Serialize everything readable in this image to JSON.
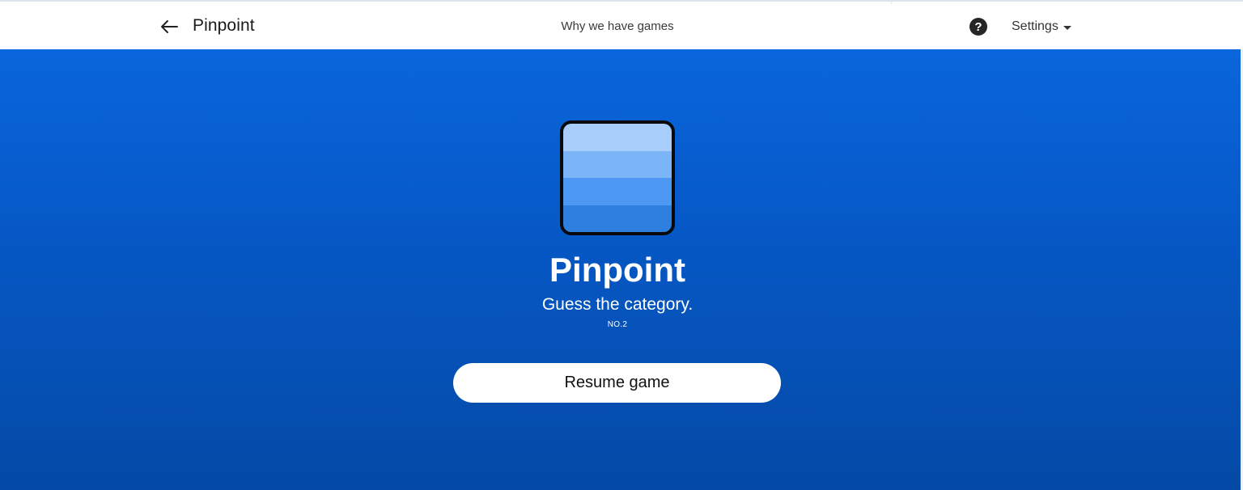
{
  "header": {
    "brand": "Pinpoint",
    "center_link": "Why we have games",
    "help_glyph": "?",
    "settings_label": "Settings"
  },
  "game": {
    "title": "Pinpoint",
    "subtitle": "Guess the category.",
    "number": "NO.2",
    "resume_label": "Resume game"
  },
  "icons": {
    "back": "arrow-left-icon",
    "help": "question-circle-icon",
    "settings_caret": "caret-down-icon"
  },
  "colors": {
    "hero_top": "#0a66dc",
    "hero_bottom": "#044aa6",
    "logo_bands": [
      "#a9cdfb",
      "#7cb4f8",
      "#4c98f2",
      "#2f7fe0"
    ]
  }
}
